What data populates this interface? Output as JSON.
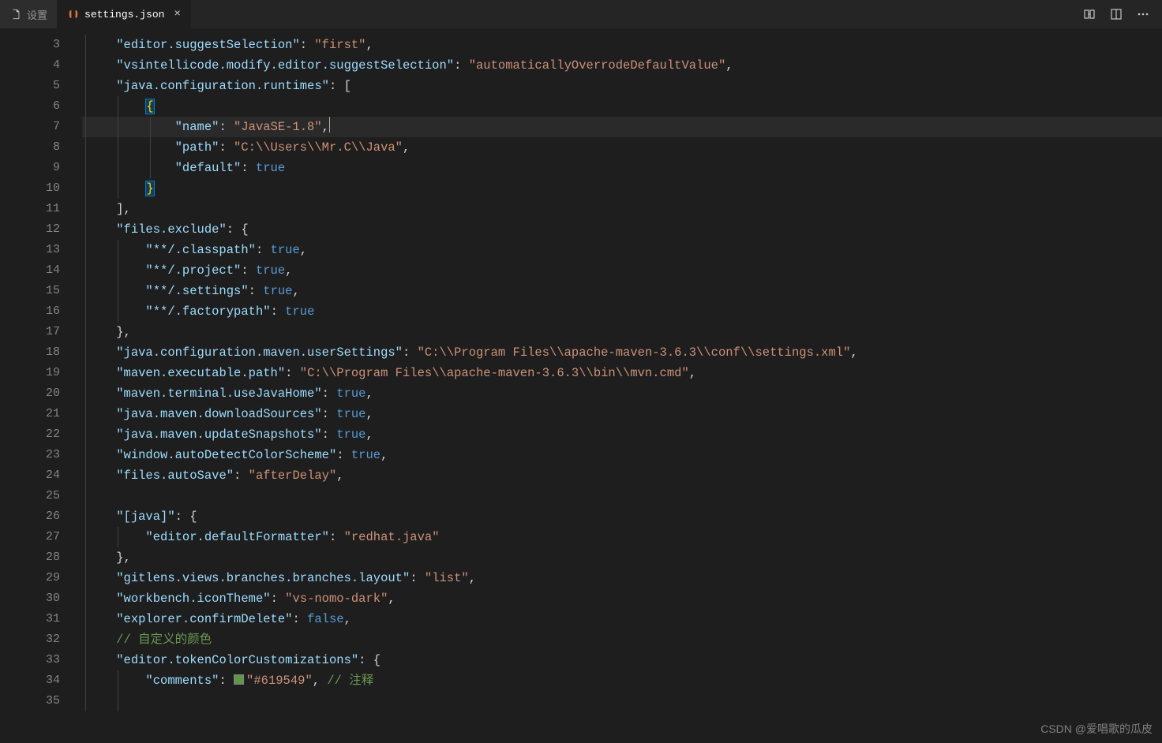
{
  "tabs": [
    {
      "label": "设置",
      "icon": "file-icon",
      "active": false
    },
    {
      "label": "settings.json",
      "icon": "json-icon",
      "active": true
    }
  ],
  "title_actions": {
    "compare": "compare-icon",
    "split": "split-editor-icon",
    "more": "more-icon"
  },
  "line_start": 3,
  "line_end": 35,
  "cursor_line": 7,
  "code_lines": [
    {
      "n": 3,
      "ind": 1,
      "tokens": [
        [
          "    ",
          "punc"
        ],
        [
          "\"editor.suggestSelection\"",
          "key"
        ],
        [
          ": ",
          "punc"
        ],
        [
          "\"first\"",
          "str"
        ],
        [
          ",",
          "punc"
        ]
      ]
    },
    {
      "n": 4,
      "ind": 1,
      "tokens": [
        [
          "    ",
          "punc"
        ],
        [
          "\"vsintellicode.modify.editor.suggestSelection\"",
          "key"
        ],
        [
          ": ",
          "punc"
        ],
        [
          "\"automaticallyOverrodeDefaultValue\"",
          "str"
        ],
        [
          ",",
          "punc"
        ]
      ]
    },
    {
      "n": 5,
      "ind": 1,
      "tokens": [
        [
          "    ",
          "punc"
        ],
        [
          "\"java.configuration.runtimes\"",
          "key"
        ],
        [
          ": ",
          "punc"
        ],
        [
          "[",
          "bracket"
        ]
      ]
    },
    {
      "n": 6,
      "ind": 2,
      "tokens": [
        [
          "        ",
          "punc"
        ],
        [
          "{",
          "bracket-blue"
        ]
      ]
    },
    {
      "n": 7,
      "ind": 3,
      "cursor": true,
      "tokens": [
        [
          "            ",
          "punc"
        ],
        [
          "\"name\"",
          "key"
        ],
        [
          ": ",
          "punc"
        ],
        [
          "\"JavaSE-1.8\"",
          "str"
        ],
        [
          ",",
          "punc"
        ]
      ]
    },
    {
      "n": 8,
      "ind": 3,
      "tokens": [
        [
          "            ",
          "punc"
        ],
        [
          "\"path\"",
          "key"
        ],
        [
          ": ",
          "punc"
        ],
        [
          "\"C:\\\\Users\\\\Mr.C\\\\Java\"",
          "str"
        ],
        [
          ",",
          "punc"
        ]
      ]
    },
    {
      "n": 9,
      "ind": 3,
      "tokens": [
        [
          "            ",
          "punc"
        ],
        [
          "\"default\"",
          "key"
        ],
        [
          ": ",
          "punc"
        ],
        [
          "true",
          "bool"
        ]
      ]
    },
    {
      "n": 10,
      "ind": 2,
      "tokens": [
        [
          "        ",
          "punc"
        ],
        [
          "}",
          "bracket-blue"
        ]
      ]
    },
    {
      "n": 11,
      "ind": 1,
      "tokens": [
        [
          "    ",
          "punc"
        ],
        [
          "]",
          "bracket"
        ],
        [
          ",",
          "punc"
        ]
      ]
    },
    {
      "n": 12,
      "ind": 1,
      "tokens": [
        [
          "    ",
          "punc"
        ],
        [
          "\"files.exclude\"",
          "key"
        ],
        [
          ": ",
          "punc"
        ],
        [
          "{",
          "bracket"
        ]
      ]
    },
    {
      "n": 13,
      "ind": 2,
      "tokens": [
        [
          "        ",
          "punc"
        ],
        [
          "\"**/.classpath\"",
          "key"
        ],
        [
          ": ",
          "punc"
        ],
        [
          "true",
          "bool"
        ],
        [
          ",",
          "punc"
        ]
      ]
    },
    {
      "n": 14,
      "ind": 2,
      "tokens": [
        [
          "        ",
          "punc"
        ],
        [
          "\"**/.project\"",
          "key"
        ],
        [
          ": ",
          "punc"
        ],
        [
          "true",
          "bool"
        ],
        [
          ",",
          "punc"
        ]
      ]
    },
    {
      "n": 15,
      "ind": 2,
      "tokens": [
        [
          "        ",
          "punc"
        ],
        [
          "\"**/.settings\"",
          "key"
        ],
        [
          ": ",
          "punc"
        ],
        [
          "true",
          "bool"
        ],
        [
          ",",
          "punc"
        ]
      ]
    },
    {
      "n": 16,
      "ind": 2,
      "tokens": [
        [
          "        ",
          "punc"
        ],
        [
          "\"**/.factorypath\"",
          "key"
        ],
        [
          ": ",
          "punc"
        ],
        [
          "true",
          "bool"
        ]
      ]
    },
    {
      "n": 17,
      "ind": 1,
      "tokens": [
        [
          "    ",
          "punc"
        ],
        [
          "}",
          "bracket"
        ],
        [
          ",",
          "punc"
        ]
      ]
    },
    {
      "n": 18,
      "ind": 1,
      "tokens": [
        [
          "    ",
          "punc"
        ],
        [
          "\"java.configuration.maven.userSettings\"",
          "key"
        ],
        [
          ": ",
          "punc"
        ],
        [
          "\"C:\\\\Program Files\\\\apache-maven-3.6.3\\\\conf\\\\settings.xml\"",
          "str"
        ],
        [
          ",",
          "punc"
        ]
      ]
    },
    {
      "n": 19,
      "ind": 1,
      "tokens": [
        [
          "    ",
          "punc"
        ],
        [
          "\"maven.executable.path\"",
          "key"
        ],
        [
          ": ",
          "punc"
        ],
        [
          "\"C:\\\\Program Files\\\\apache-maven-3.6.3\\\\bin\\\\mvn.cmd\"",
          "str"
        ],
        [
          ",",
          "punc"
        ]
      ]
    },
    {
      "n": 20,
      "ind": 1,
      "tokens": [
        [
          "    ",
          "punc"
        ],
        [
          "\"maven.terminal.useJavaHome\"",
          "key"
        ],
        [
          ": ",
          "punc"
        ],
        [
          "true",
          "bool"
        ],
        [
          ",",
          "punc"
        ]
      ]
    },
    {
      "n": 21,
      "ind": 1,
      "tokens": [
        [
          "    ",
          "punc"
        ],
        [
          "\"java.maven.downloadSources\"",
          "key"
        ],
        [
          ": ",
          "punc"
        ],
        [
          "true",
          "bool"
        ],
        [
          ",",
          "punc"
        ]
      ]
    },
    {
      "n": 22,
      "ind": 1,
      "tokens": [
        [
          "    ",
          "punc"
        ],
        [
          "\"java.maven.updateSnapshots\"",
          "key"
        ],
        [
          ": ",
          "punc"
        ],
        [
          "true",
          "bool"
        ],
        [
          ",",
          "punc"
        ]
      ]
    },
    {
      "n": 23,
      "ind": 1,
      "tokens": [
        [
          "    ",
          "punc"
        ],
        [
          "\"window.autoDetectColorScheme\"",
          "key"
        ],
        [
          ": ",
          "punc"
        ],
        [
          "true",
          "bool"
        ],
        [
          ",",
          "punc"
        ]
      ]
    },
    {
      "n": 24,
      "ind": 1,
      "tokens": [
        [
          "    ",
          "punc"
        ],
        [
          "\"files.autoSave\"",
          "key"
        ],
        [
          ": ",
          "punc"
        ],
        [
          "\"afterDelay\"",
          "str"
        ],
        [
          ",",
          "punc"
        ]
      ]
    },
    {
      "n": 25,
      "ind": 1,
      "tokens": []
    },
    {
      "n": 26,
      "ind": 1,
      "tokens": [
        [
          "    ",
          "punc"
        ],
        [
          "\"[java]\"",
          "key"
        ],
        [
          ": ",
          "punc"
        ],
        [
          "{",
          "bracket"
        ]
      ]
    },
    {
      "n": 27,
      "ind": 2,
      "tokens": [
        [
          "        ",
          "punc"
        ],
        [
          "\"editor.defaultFormatter\"",
          "key"
        ],
        [
          ": ",
          "punc"
        ],
        [
          "\"redhat.java\"",
          "str"
        ]
      ]
    },
    {
      "n": 28,
      "ind": 1,
      "tokens": [
        [
          "    ",
          "punc"
        ],
        [
          "}",
          "bracket"
        ],
        [
          ",",
          "punc"
        ]
      ]
    },
    {
      "n": 29,
      "ind": 1,
      "tokens": [
        [
          "    ",
          "punc"
        ],
        [
          "\"gitlens.views.branches.branches.layout\"",
          "key"
        ],
        [
          ": ",
          "punc"
        ],
        [
          "\"list\"",
          "str"
        ],
        [
          ",",
          "punc"
        ]
      ]
    },
    {
      "n": 30,
      "ind": 1,
      "tokens": [
        [
          "    ",
          "punc"
        ],
        [
          "\"workbench.iconTheme\"",
          "key"
        ],
        [
          ": ",
          "punc"
        ],
        [
          "\"vs-nomo-dark\"",
          "str"
        ],
        [
          ",",
          "punc"
        ]
      ]
    },
    {
      "n": 31,
      "ind": 1,
      "tokens": [
        [
          "    ",
          "punc"
        ],
        [
          "\"explorer.confirmDelete\"",
          "key"
        ],
        [
          ": ",
          "punc"
        ],
        [
          "false",
          "bool"
        ],
        [
          ",",
          "punc"
        ]
      ]
    },
    {
      "n": 32,
      "ind": 1,
      "tokens": [
        [
          "    ",
          "punc"
        ],
        [
          "// 自定义的颜色",
          "comment"
        ]
      ]
    },
    {
      "n": 33,
      "ind": 1,
      "tokens": [
        [
          "    ",
          "punc"
        ],
        [
          "\"editor.tokenColorCustomizations\"",
          "key"
        ],
        [
          ": ",
          "punc"
        ],
        [
          "{",
          "bracket"
        ]
      ]
    },
    {
      "n": 34,
      "ind": 2,
      "swatch": "#619549",
      "tokens": [
        [
          "        ",
          "punc"
        ],
        [
          "\"comments\"",
          "key"
        ],
        [
          ": ",
          "punc"
        ],
        [
          "SWATCH",
          "swatch"
        ],
        [
          "\"#619549\"",
          "str"
        ],
        [
          ", ",
          "punc"
        ],
        [
          "// 注释",
          "comment"
        ]
      ]
    },
    {
      "n": 35,
      "ind": 2,
      "tokens": []
    }
  ],
  "watermark": "CSDN @爱唱歌的瓜皮"
}
